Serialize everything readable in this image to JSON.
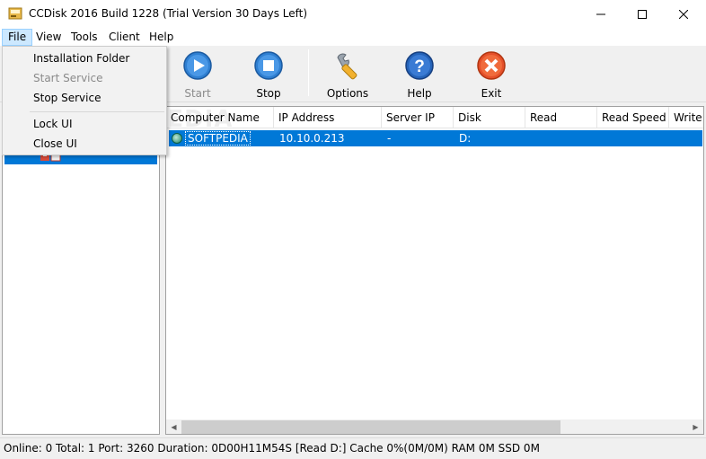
{
  "window": {
    "title": "CCDisk 2016 Build 1228 (Trial Version 30 Days Left)",
    "icon": "app-disk-icon",
    "controls": [
      "minimize-icon",
      "maximize-icon",
      "close-icon"
    ]
  },
  "menubar": {
    "items": [
      {
        "label": "File",
        "active": true
      },
      {
        "label": "View"
      },
      {
        "label": "Tools"
      },
      {
        "label": "Client"
      },
      {
        "label": "Help"
      }
    ]
  },
  "file_menu": {
    "items": [
      {
        "label": "Installation Folder",
        "enabled": true
      },
      {
        "label": "Start Service",
        "enabled": false
      },
      {
        "label": "Stop Service",
        "enabled": true
      },
      {
        "label": "Lock UI",
        "enabled": true
      },
      {
        "label": "Close UI",
        "enabled": true
      }
    ]
  },
  "toolbar": {
    "buttons": [
      {
        "label": "Start",
        "icon": "play-icon",
        "enabled": false
      },
      {
        "label": "Stop",
        "icon": "stop-icon",
        "enabled": true
      },
      {
        "label": "Options",
        "icon": "wrench-icon",
        "enabled": true
      },
      {
        "label": "Help",
        "icon": "help-icon",
        "enabled": true
      },
      {
        "label": "Exit",
        "icon": "exit-icon",
        "enabled": true
      }
    ]
  },
  "table": {
    "columns": [
      "Computer Name",
      "IP Address",
      "Server IP",
      "Disk",
      "Read",
      "Read Speed",
      "Write"
    ],
    "rows": [
      {
        "computer_name": "SOFTPEDIA",
        "ip_address": "10.10.0.213",
        "server_ip": "-",
        "disk": "D:",
        "read": "",
        "read_speed": "",
        "write": "",
        "status_icon": "online-dot-icon",
        "selected": true
      }
    ]
  },
  "watermark": "SOFTPEDIA",
  "status": {
    "text": "Online: 0 Total: 1 Port: 3260 Duration: 0D00H11M54S [Read D:] Cache 0%(0M/0M) RAM 0M SSD 0M"
  },
  "colors": {
    "selection": "#0078d7",
    "menu_active": "#cce8ff",
    "window_bg": "#f0f0f0"
  }
}
